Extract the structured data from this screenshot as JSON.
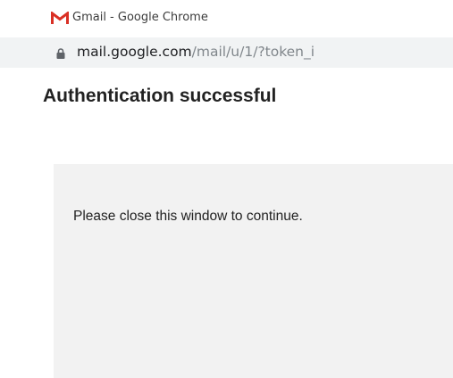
{
  "browser": {
    "window_title": "Gmail - Google Chrome",
    "favicon": "gmail-icon",
    "address": {
      "lock_icon": "lock-icon",
      "host": "mail.google.com",
      "path": "/mail/u/1/?token_i"
    }
  },
  "page": {
    "heading": "Authentication successful",
    "message": "Please close this window to continue."
  },
  "colors": {
    "gmail_red": "#d93025",
    "address_bar_bg": "#f1f3f4",
    "panel_bg": "#f2f2f2"
  }
}
